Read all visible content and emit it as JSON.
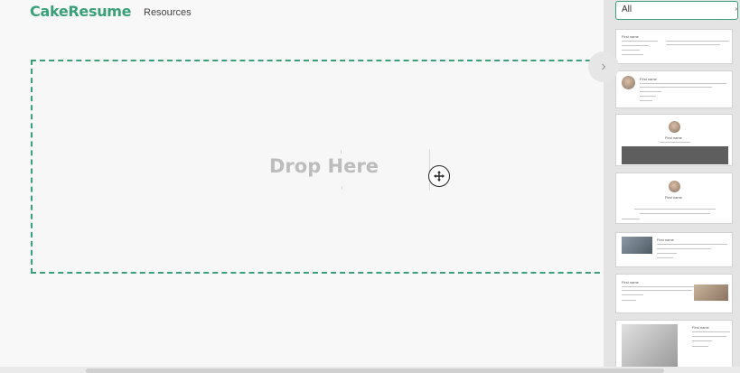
{
  "header": {
    "logo": "CakeResume",
    "nav_resources": "Resources"
  },
  "canvas": {
    "drop_label": "Drop Here"
  },
  "panel": {
    "filter_value": "All",
    "clear_symbol": "×",
    "collapse_icon": "chevron-right-icon",
    "templates": [
      {
        "name": "First name"
      },
      {
        "name": "First name"
      },
      {
        "name": "First name"
      },
      {
        "name": "First name"
      },
      {
        "name": "First name"
      },
      {
        "name": "First name"
      },
      {
        "name": "First name"
      }
    ]
  },
  "colors": {
    "accent": "#3aa07a",
    "drop_text": "#bdbdbd",
    "panel_bg": "#e4e4e4"
  }
}
